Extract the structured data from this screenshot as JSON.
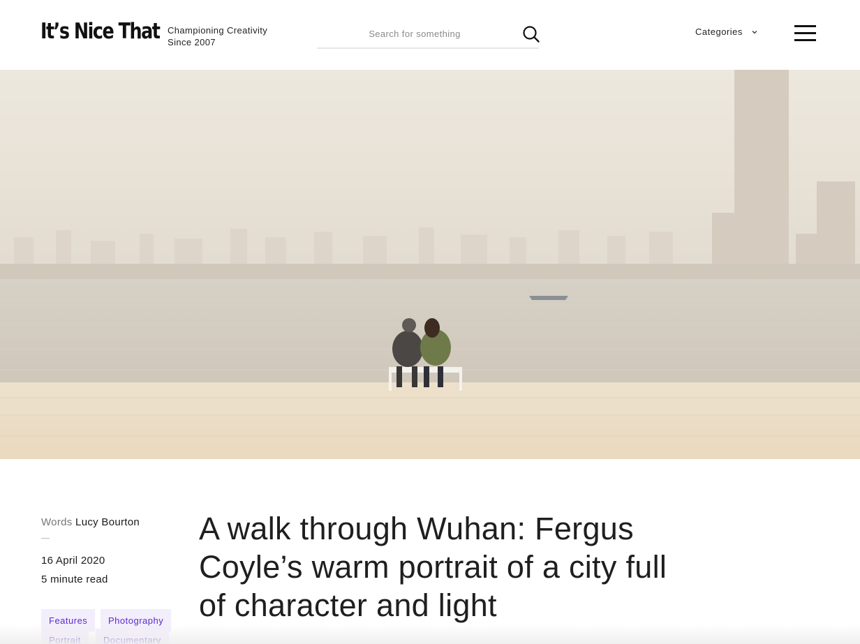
{
  "header": {
    "logo": "It’s Nice That",
    "tagline_line1": "Championing Creativity",
    "tagline_line2": "Since 2007",
    "search_placeholder": "Search for something",
    "categories_label": "Categories"
  },
  "icons": {
    "search": "search-icon",
    "categories_chevron": "chevron-down-icon",
    "menu": "hamburger-menu-icon"
  },
  "article": {
    "words_label": "Words",
    "author": "Lucy Bourton",
    "date": "16 April 2020",
    "read_time": "5 minute read",
    "title": "A walk through Wuhan: Fergus Coyle’s warm portrait of a city full of character and light",
    "tags": [
      "Features",
      "Photography",
      "Portrait",
      "Documentary"
    ]
  },
  "colors": {
    "tag_background": "#f3eefb",
    "tag_text": "#5a2bd0",
    "text": "#1f1f1f"
  }
}
